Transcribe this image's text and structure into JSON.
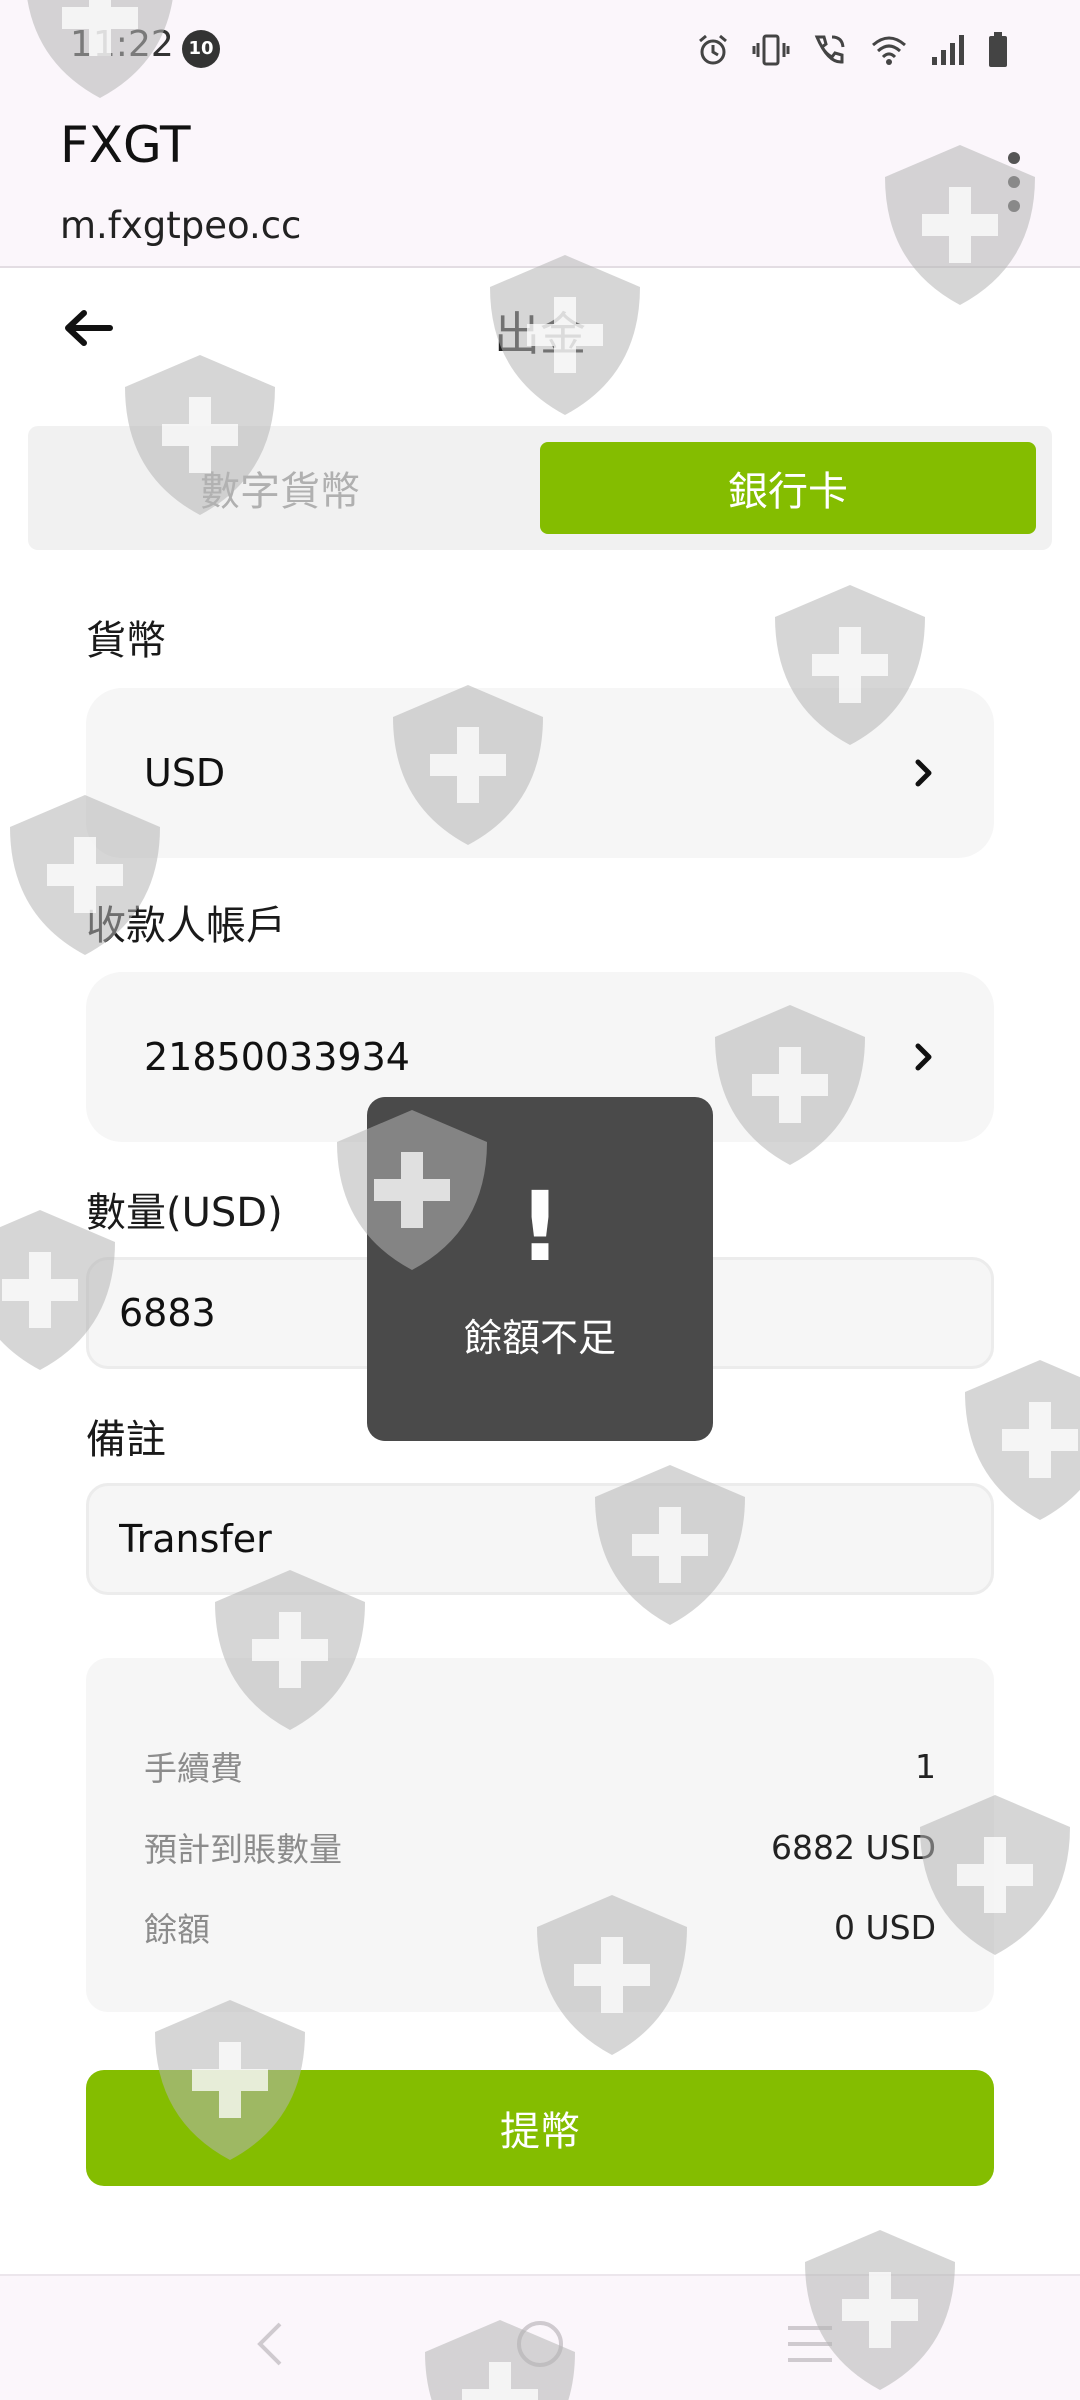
{
  "status_bar": {
    "time": "11:22",
    "notification_count": "10",
    "icons": [
      "alarm-icon",
      "vibrate-icon",
      "wifi-call-icon",
      "wifi-icon",
      "signal-icon",
      "battery-icon"
    ]
  },
  "browser": {
    "title": "FXGT",
    "url": "m.fxgtpeo.cc",
    "menu_icon": "kebab-menu-icon"
  },
  "header": {
    "title": "出金",
    "back_icon": "arrow-left-icon"
  },
  "tabs": [
    {
      "label": "數字貨幣",
      "selected": false
    },
    {
      "label": "銀行卡",
      "selected": true
    }
  ],
  "form": {
    "currency": {
      "label": "貨幣",
      "value": "USD"
    },
    "payee_account": {
      "label": "收款人帳戶",
      "value": "21850033934"
    },
    "amount": {
      "label": "數量(USD)",
      "value": "6883"
    },
    "remark": {
      "label": "備註",
      "value": "Transfer"
    }
  },
  "summary": {
    "fee_label": "手續費",
    "fee_value": "1",
    "expected_label": "預計到賬數量",
    "expected_value": "6882 USD",
    "balance_label": "餘額",
    "balance_value": "0 USD"
  },
  "submit_label": "提幣",
  "toast": {
    "icon": "!",
    "message": "餘額不足"
  },
  "colors": {
    "accent": "#84bd00",
    "toast_bg": "#4a4a4a",
    "field_bg": "#f6f6f6"
  }
}
